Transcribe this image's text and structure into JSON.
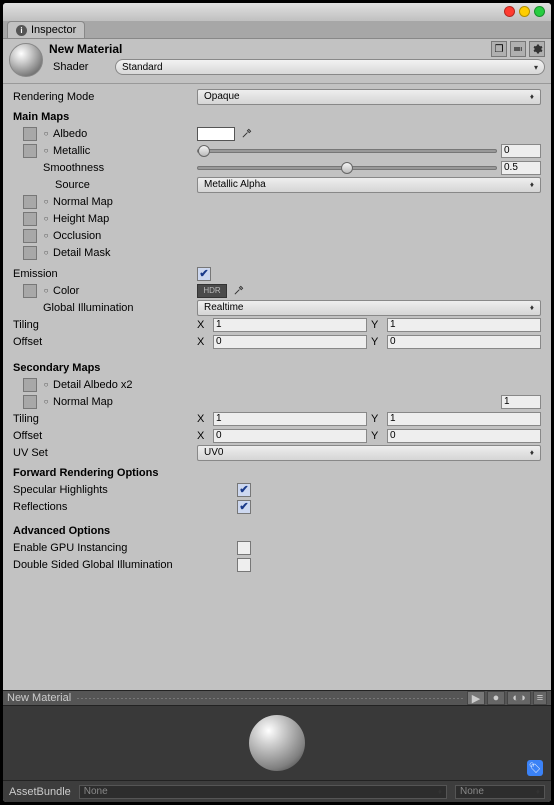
{
  "tab": {
    "label": "Inspector"
  },
  "header": {
    "name": "New Material",
    "shader_label": "Shader",
    "shader_value": "Standard"
  },
  "rendering": {
    "label": "Rendering Mode",
    "value": "Opaque"
  },
  "mainmaps": {
    "title": "Main Maps",
    "albedo": "Albedo",
    "metallic": "Metallic",
    "metallic_val": "0",
    "smoothness": "Smoothness",
    "smoothness_val": "0.5",
    "source": "Source",
    "source_val": "Metallic Alpha",
    "normal": "Normal Map",
    "height": "Height Map",
    "occlusion": "Occlusion",
    "detailmask": "Detail Mask"
  },
  "emission": {
    "label": "Emission",
    "color": "Color",
    "hdr_badge": "HDR",
    "gi": "Global Illumination",
    "gi_val": "Realtime"
  },
  "tiling": {
    "tiling": "Tiling",
    "offset": "Offset",
    "x": "X",
    "y": "Y",
    "tx": "1",
    "ty": "1",
    "ox": "0",
    "oy": "0"
  },
  "secondary": {
    "title": "Secondary Maps",
    "detail_albedo": "Detail Albedo x2",
    "normal": "Normal Map",
    "normal_val": "1",
    "tiling": "Tiling",
    "offset": "Offset",
    "tx": "1",
    "ty": "1",
    "ox": "0",
    "oy": "0",
    "uvset": "UV Set",
    "uvset_val": "UV0"
  },
  "forward": {
    "title": "Forward Rendering Options",
    "specular": "Specular Highlights",
    "reflections": "Reflections"
  },
  "advanced": {
    "title": "Advanced Options",
    "gpu": "Enable GPU Instancing",
    "double": "Double Sided Global Illumination"
  },
  "preview": {
    "title": "New Material"
  },
  "assetbundle": {
    "label": "AssetBundle",
    "val1": "None",
    "val2": "None"
  }
}
